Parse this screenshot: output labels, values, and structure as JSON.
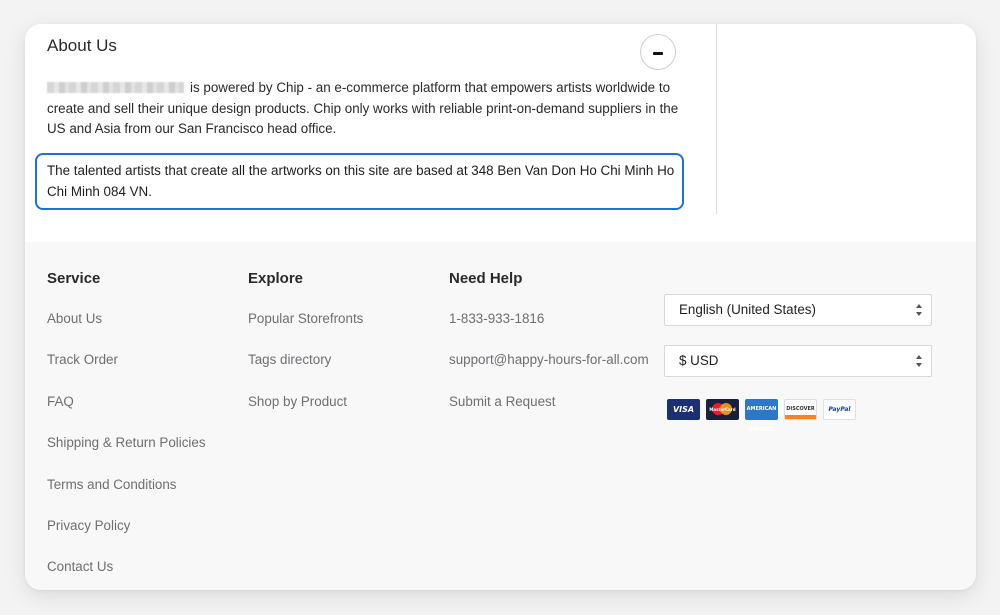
{
  "about": {
    "title": "About Us",
    "paragraph1": "is powered by Chip - an e-commerce platform that empowers artists worldwide to create and sell their unique design products. Chip only works with reliable print-on-demand suppliers in the US and Asia from our San Francisco head office.",
    "paragraph2": "The talented artists that create all the artworks on this site are based at 348 Ben Van Don Ho Chi Minh Ho Chi Minh 084 VN."
  },
  "footer": {
    "service": {
      "heading": "Service",
      "links": [
        "About Us",
        "Track Order",
        "FAQ",
        "Shipping & Return Policies",
        "Terms and Conditions",
        "Privacy Policy",
        "Contact Us"
      ]
    },
    "explore": {
      "heading": "Explore",
      "links": [
        "Popular Storefronts",
        "Tags directory",
        "Shop by Product"
      ]
    },
    "help": {
      "heading": "Need Help",
      "links": [
        "1-833-933-1816",
        "support@happy-hours-for-all.com",
        "Submit a Request"
      ]
    },
    "language_select": "English (United States)",
    "currency_select": "$ USD",
    "payments": {
      "visa": "VISA",
      "mastercard": "MasterCard",
      "amex": "AMERICAN EXPRESS",
      "discover": "DISCOVER",
      "paypal": "PayPal"
    }
  },
  "colors": {
    "highlight_border": "#1a73d9",
    "footer_bg": "#f8f8f9",
    "link_text": "#6e6e73"
  }
}
